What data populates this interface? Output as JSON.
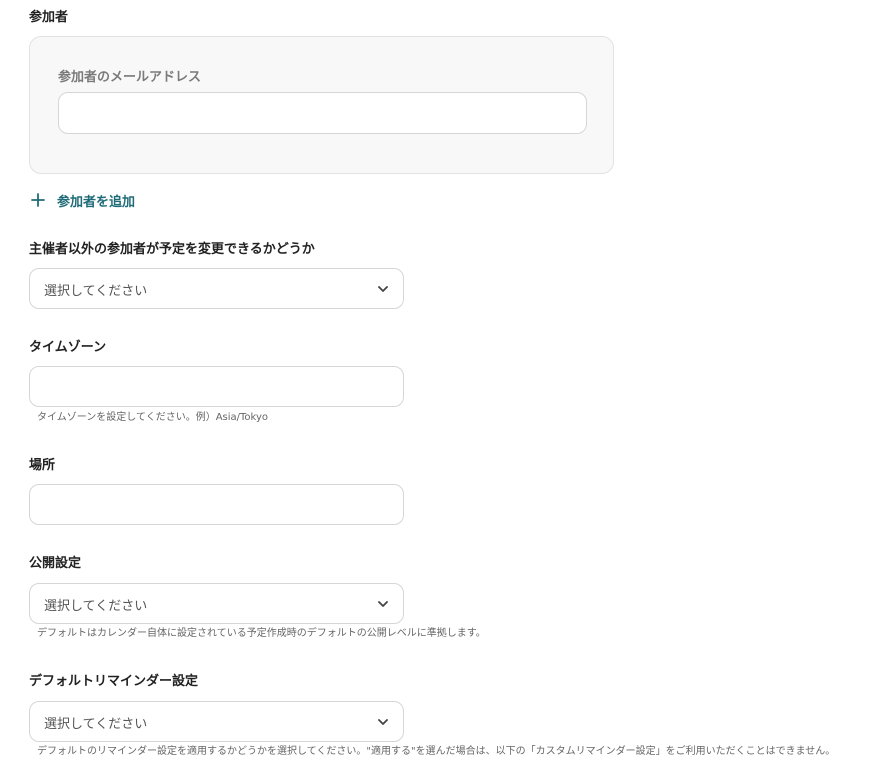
{
  "attendees": {
    "section_label": "参加者",
    "email_label": "参加者のメールアドレス",
    "email_value": "",
    "add_label": "参加者を追加"
  },
  "guests_can_modify": {
    "label": "主催者以外の参加者が予定を変更できるかどうか",
    "selected": "選択してください"
  },
  "timezone": {
    "label": "タイムゾーン",
    "value": "",
    "help": "タイムゾーンを設定してください。例）Asia/Tokyo"
  },
  "location": {
    "label": "場所",
    "value": ""
  },
  "visibility": {
    "label": "公開設定",
    "selected": "選択してください",
    "help": "デフォルトはカレンダー自体に設定されている予定作成時のデフォルトの公開レベルに準拠します。"
  },
  "default_reminder": {
    "label": "デフォルトリマインダー設定",
    "selected": "選択してください",
    "help": "デフォルトのリマインダー設定を適用するかどうかを選択してください。\"適用する\"を選んだ場合は、以下の「カスタムリマインダー設定」をご利用いただくことはできません。"
  },
  "icons": {
    "chevron": "chevron-down-icon",
    "plus": "plus-icon"
  },
  "colors": {
    "accent": "#1f6b78",
    "box_bg": "#f8f8f8",
    "border": "#d6d6d6"
  }
}
